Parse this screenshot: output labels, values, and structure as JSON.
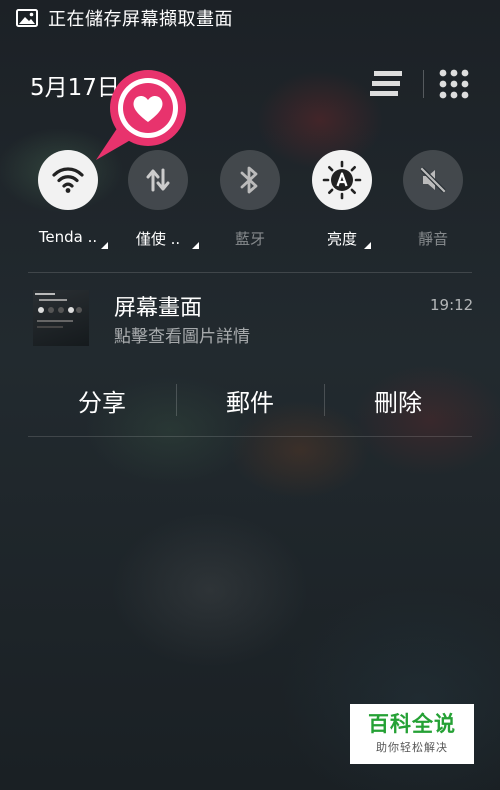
{
  "status_bar": {
    "icon": "image-icon",
    "text": "正在儲存屏幕擷取畫面"
  },
  "header": {
    "date": "5月17日",
    "list_icon": "list-icon",
    "grid_icon": "grid-icon"
  },
  "overlay_badge": {
    "icon": "heart-icon",
    "color": "#e8336d"
  },
  "quick_toggles": [
    {
      "label": "Tenda ..",
      "icon": "wifi-icon",
      "state": "on",
      "expandable": true
    },
    {
      "label": "僅使 ..",
      "icon": "data-transfer-icon",
      "state": "off",
      "expandable": true
    },
    {
      "label": "藍牙",
      "icon": "bluetooth-icon",
      "state": "off",
      "expandable": false
    },
    {
      "label": "亮度",
      "icon": "brightness-auto-icon",
      "state": "on",
      "expandable": true
    },
    {
      "label": "靜音",
      "icon": "mute-icon",
      "state": "off",
      "expandable": false
    }
  ],
  "notification": {
    "title": "屏幕畫面",
    "subtitle": "點擊查看圖片詳情",
    "time": "19:12",
    "actions": [
      "分享",
      "郵件",
      "刪除"
    ]
  },
  "watermark": {
    "title": "百科全说",
    "subtitle": "助你轻松解决",
    "color": "#25a135"
  }
}
